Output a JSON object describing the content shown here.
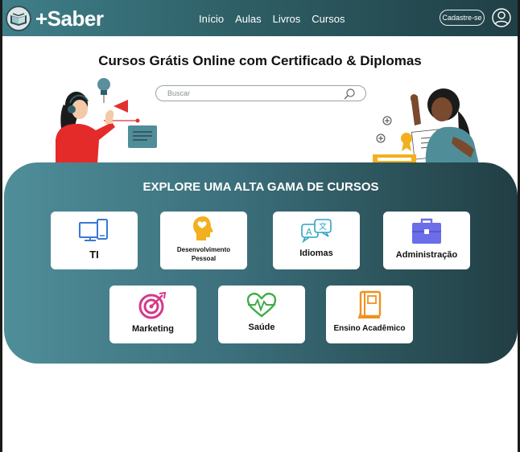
{
  "brand": {
    "name": "+Saber"
  },
  "nav": {
    "items": [
      "Início",
      "Aulas",
      "Livros",
      "Cursos"
    ],
    "signup_label": "Cadastre-se"
  },
  "hero": {
    "title": "Cursos Grátis Online com Certificado & Diplomas",
    "search_placeholder": "Buscar"
  },
  "explore": {
    "title": "EXPLORE UMA ALTA GAMA DE CURSOS",
    "categories": [
      {
        "label": "TI",
        "icon": "computer-icon"
      },
      {
        "label": "Desenvolvimento Pessoal",
        "icon": "head-heart-icon"
      },
      {
        "label": "Idiomas",
        "icon": "translate-icon"
      },
      {
        "label": "Administração",
        "icon": "briefcase-icon"
      },
      {
        "label": "Marketing",
        "icon": "target-icon"
      },
      {
        "label": "Saúde",
        "icon": "heartbeat-icon"
      },
      {
        "label": "Ensino Acadêmico",
        "icon": "book-icon"
      }
    ]
  },
  "colors": {
    "header_start": "#3f7f8a",
    "header_end": "#1f3f45",
    "panel_start": "#4f8e99",
    "panel_end": "#213e44"
  }
}
